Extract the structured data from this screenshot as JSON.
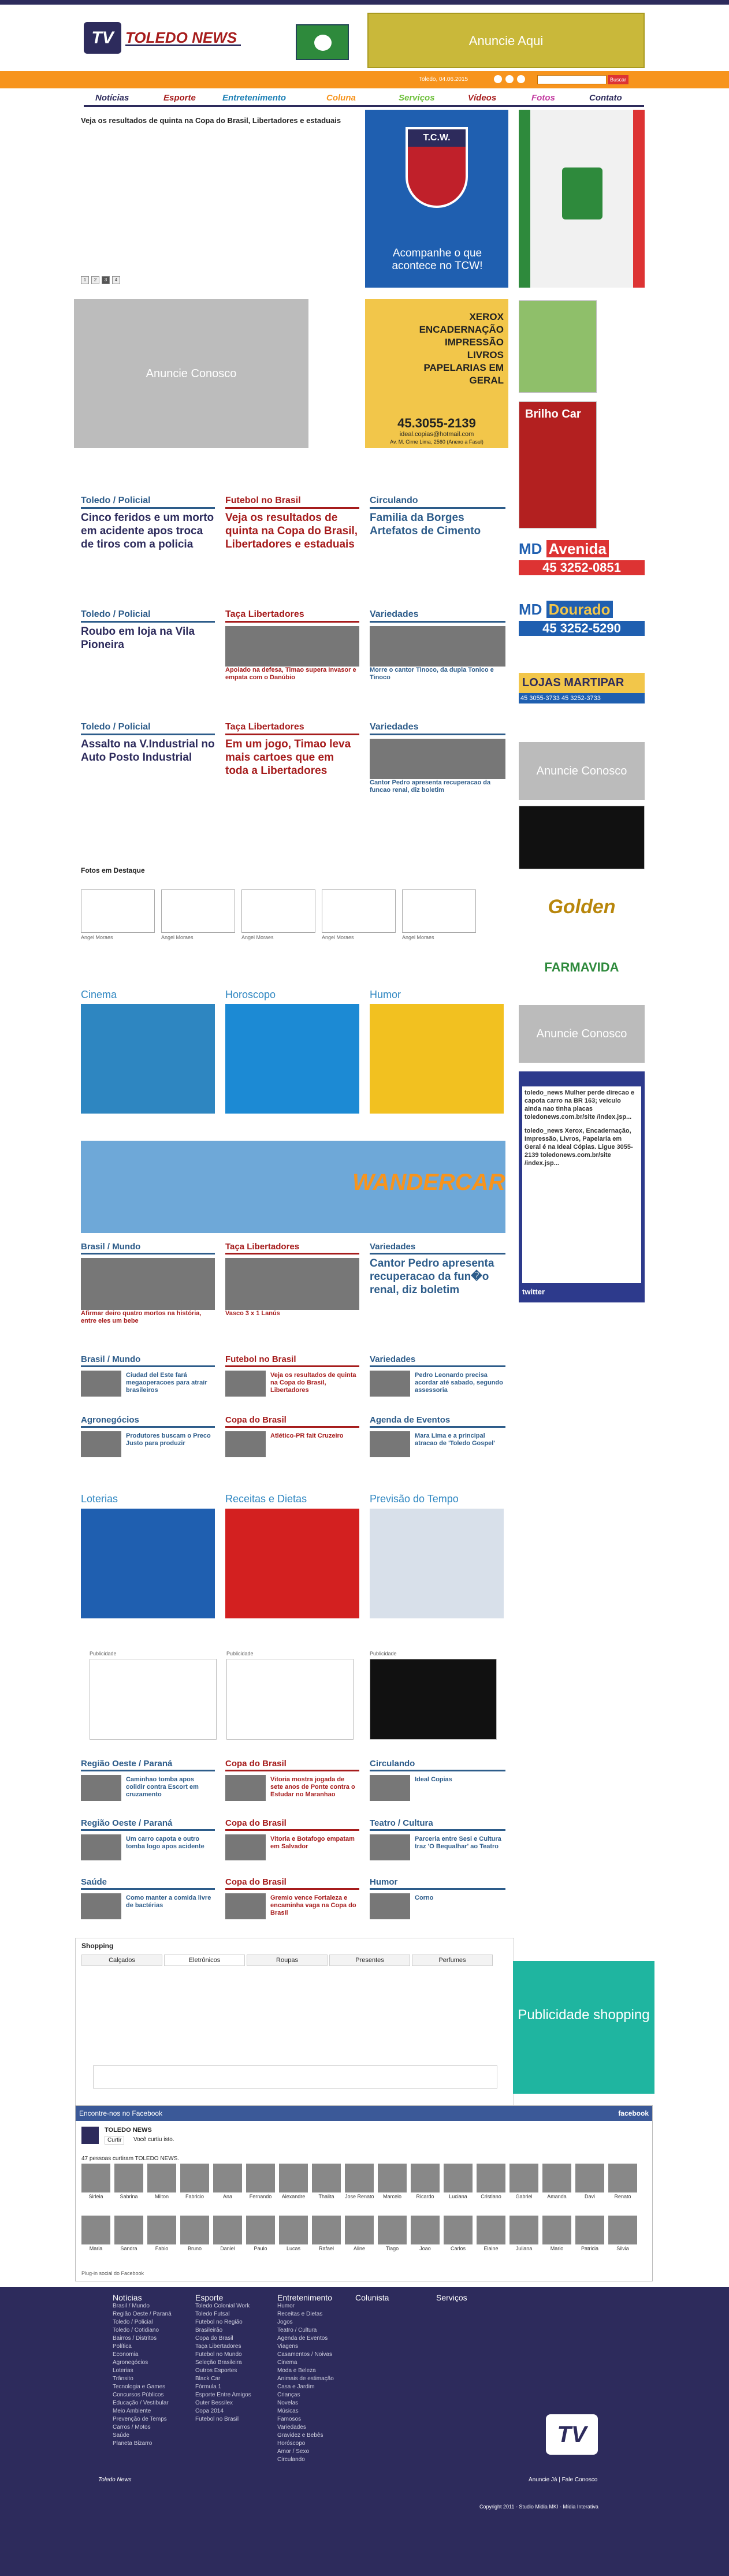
{
  "header": {
    "logo_text": "TOLEDO NEWS",
    "ad_text": "Anuncie Aqui",
    "date": "Toledo, 04.06.2015",
    "search_button": "Buscar"
  },
  "nav": [
    "Notícias",
    "Esporte",
    "Entretenimento",
    "Coluna",
    "Serviços",
    "Vídeos",
    "Fotos",
    "Contato"
  ],
  "nav_colors": [
    "#2d2b5c",
    "#a61c1c",
    "#1b7fb5",
    "#f7941d",
    "#6cbf3a",
    "#a61c1c",
    "#c23aa0",
    "#2d2b5c"
  ],
  "slider": {
    "caption": "Veja os resultados de quinta na Copa do Brasil, Libertadores e estaduais",
    "pages": [
      "1",
      "2",
      "3",
      "4"
    ]
  },
  "promo": {
    "text": "Acompanhe o que acontece no TCW!",
    "club": "T.C.W."
  },
  "anuncie": "Anuncie Conosco",
  "xerox": {
    "lines": [
      "XEROX",
      "ENCADERNAÇÃO",
      "IMPRESSÃO",
      "LIVROS",
      "PAPELARIAS EM GERAL"
    ],
    "phone": "45.3055-2139",
    "email": "ideal.copias@hotmail.com",
    "addr": "Av. M. Cirne Lima, 2560 (Anexo a Fasul)"
  },
  "row1": [
    {
      "cat": "Toledo / Policial",
      "title": "Cinco feridos e um morto em acidente apos troca de tiros com a policia",
      "color": "#2d5c8a"
    },
    {
      "cat": "Futebol no Brasil",
      "title": "Veja os resultados de quinta na Copa do Brasil, Libertadores e estaduais",
      "color": "#a61c1c"
    },
    {
      "cat": "Circulando",
      "title": "Familia da Borges Artefatos de Cimento",
      "color": "#2d5c8a"
    }
  ],
  "row2": [
    {
      "cat": "Toledo / Policial",
      "title": "Roubo em loja na Vila Pioneira"
    },
    {
      "cat": "Taça Libertadores",
      "caption": "Apoiado na defesa, Timao supera Invasor e empata com o Danúbio"
    },
    {
      "cat": "Variedades",
      "caption": "Morre o cantor Tinoco, da dupla Tonico e Tinoco"
    }
  ],
  "row3": [
    {
      "cat": "Toledo / Policial",
      "title": "Assalto na V.Industrial no Auto Posto Industrial"
    },
    {
      "cat": "Taça Libertadores",
      "title": "Em um jogo, Timao leva mais cartoes que em toda a Libertadores"
    },
    {
      "cat": "Variedades",
      "caption": "Cantor Pedro apresenta recuperacao da funcao renal, diz boletim"
    }
  ],
  "fotos": {
    "title": "Fotos em Destaque",
    "items": [
      "Angel Moraes",
      "Angel Moraes",
      "Angel Moraes",
      "Angel Moraes",
      "Angel Moraes"
    ]
  },
  "tiles1": [
    {
      "label": "Cinema",
      "color": "#2e86c1"
    },
    {
      "label": "Horoscopo",
      "color": "#2e86c1"
    },
    {
      "label": "Humor",
      "color": "#2e86c1"
    }
  ],
  "banner_text": "WANDERCAR",
  "row4": [
    {
      "cat": "Brasil / Mundo",
      "caption": "Afirmar deiro quatro mortos na história, entre eles um bebe"
    },
    {
      "cat": "Taça Libertadores",
      "caption": "Vasco 3 x 1 Lanús"
    },
    {
      "cat": "Variedades",
      "title": "Cantor Pedro apresenta recuperacao da fun�o renal, diz boletim"
    }
  ],
  "row5": [
    {
      "cat": "Brasil / Mundo",
      "caption": "Ciudad del Este fará megaoperacoes para atrair brasileiros"
    },
    {
      "cat": "Futebol no Brasil",
      "caption": "Veja os resultados de quinta na Copa do Brasil, Libertadores"
    },
    {
      "cat": "Variedades",
      "caption": "Pedro Leonardo precisa acordar até sabado, segundo assessoria"
    }
  ],
  "row6": [
    {
      "cat": "Agronegócios",
      "caption": "Produtores buscam o Preco Justo para produzir"
    },
    {
      "cat": "Copa do Brasil",
      "caption": "Atlético-PR fait Cruzeiro"
    },
    {
      "cat": "Agenda de Eventos",
      "caption": "Mara Lima e a principal atracao de 'Toledo Gospel'"
    }
  ],
  "tiles2": [
    {
      "label": "Loterias"
    },
    {
      "label": "Receitas e Dietas"
    },
    {
      "label": "Previsão do Tempo"
    }
  ],
  "publicidade": [
    "Publicidade",
    "Publicidade",
    "Publicidade"
  ],
  "row7": [
    {
      "cat": "Região Oeste / Paraná",
      "caption": "Caminhao tomba apos colidir contra Escort em cruzamento"
    },
    {
      "cat": "Copa do Brasil",
      "caption": "Vitoria mostra jogada de sete anos de Ponte contra o Estudar no Maranhao"
    },
    {
      "cat": "Circulando",
      "caption": "Ideal Copias"
    }
  ],
  "row8": [
    {
      "cat": "Região Oeste / Paraná",
      "caption": "Um carro capota e outro tomba logo apos acidente"
    },
    {
      "cat": "Copa do Brasil",
      "caption": "Vitoria e Botafogo empatam em Salvador"
    },
    {
      "cat": "Teatro / Cultura",
      "caption": "Parceria entre Sesi e Cultura traz 'O Bequalhar' ao Teatro"
    }
  ],
  "row9": [
    {
      "cat": "Saúde",
      "caption": "Como manter a comida livre de bactérias"
    },
    {
      "cat": "Copa do Brasil",
      "caption": "Gremio vence Fortaleza e encaminha vaga na Copa do Brasil"
    },
    {
      "cat": "Humor",
      "caption": "Corno"
    }
  ],
  "shopping": {
    "title": "Shopping",
    "tabs": [
      "Calçados",
      "Eletrônicos",
      "Roupas",
      "Presentes",
      "Perfumes"
    ],
    "ad": "Publicidade shopping"
  },
  "facebook": {
    "header": "Encontre-nos no Facebook",
    "brand": "facebook",
    "page": "TOLEDO NEWS",
    "like": "Curtir",
    "likes_text": "Você curtiu isto.",
    "count_text": "47 pessoas curtiram TOLEDO NEWS.",
    "footer": "Plug-in social do Facebook",
    "people": [
      "Sirleia",
      "Sabrina",
      "Milton",
      "Fabricio",
      "Ana",
      "Fernando",
      "Alexandre",
      "Thalita",
      "Jose Renato",
      "Marcelo",
      "Ricardo",
      "Luciana",
      "Cristiano",
      "Gabriel",
      "Amanda",
      "Davi",
      "Renato",
      "Maria",
      "Sandra",
      "Fabio",
      "Bruno",
      "Daniel",
      "Paulo",
      "Lucas",
      "Rafael",
      "Aline",
      "Tiago",
      "Joao",
      "Carlos",
      "Elaine",
      "Juliana",
      "Mario",
      "Patricia",
      "Silvia"
    ]
  },
  "side": {
    "avenida": "Avenida",
    "avenida_phone": "45 3252-0851",
    "dourado": "Dourado",
    "dourado_phone": "45 3252-5290",
    "lojas": "LOJAS MARTIPAR",
    "lojas_phones": "45 3055-3733  45 3252-3733",
    "anuncie": "Anuncie Conosco",
    "golden": "Golden",
    "farmavida": "FARMAVIDA",
    "brilho": "Brilho Car"
  },
  "twitter": {
    "tweets": [
      "toledo_news Mulher perde direcao e capota carro na BR 163; veiculo ainda nao tinha placas toledonews.com.br/site /index.jsp...",
      "toledo_news Xerox, Encadernação, Impressão, Livros, Papelaria em Geral é na Ideal Cópias. Ligue 3055-2139 toledonews.com.br/site /index.jsp..."
    ],
    "brand": "twitter"
  },
  "footer": {
    "cols": [
      {
        "h": "Notícias",
        "items": [
          "Brasil / Mundo",
          "Região Oeste / Paraná",
          "Toledo / Policial",
          "Toledo / Cotidiano",
          "Bairros / Distritos",
          "Política",
          "Economia",
          "Agronegócios",
          "Loterias",
          "Trânsito",
          "Tecnologia e Games",
          "Concursos Públicos",
          "Educação / Vestibular",
          "Meio Ambiente",
          "Prevenção de Temps",
          "Carros / Motos",
          "Saúde",
          "Planeta Bizarro"
        ]
      },
      {
        "h": "Esporte",
        "items": [
          "Toledo Colonial Work",
          "Toledo Futsal",
          "Futebol no Região",
          "Brasileirão",
          "Copa do Brasil",
          "Taça Libertadores",
          "Futebol no Mundo",
          "Seleção Brasileira",
          "Outros Esportes",
          "Black Car",
          "Fórmula 1",
          "Esporte Entre Amigos",
          "Outer Bessilex",
          "Copa 2014",
          "Futebol no Brasil"
        ]
      },
      {
        "h": "Entretenimento",
        "items": [
          "Humor",
          "Receitas e Dietas",
          "Jogos",
          "Teatro / Cultura",
          "Agenda de Eventos",
          "Viagens",
          "Casamentos / Noivas",
          "Cinema",
          "Moda e Beleza",
          "Animais de estimação",
          "Casa e Jardim",
          "Crianças",
          "Novelas",
          "Músicas",
          "Famosos",
          "Variedades",
          "Gravidez e Bebês",
          "Horóscopo",
          "Amor / Sexo",
          "Circulando"
        ]
      },
      {
        "h": "Colunista",
        "items": []
      },
      {
        "h": "Serviços",
        "items": []
      }
    ],
    "links": "Anuncie Já | Fale Conosco",
    "copyright": "Copyright 2011 - Studio Midia MKI - Mídia Interativa",
    "brand": "Toledo News"
  }
}
